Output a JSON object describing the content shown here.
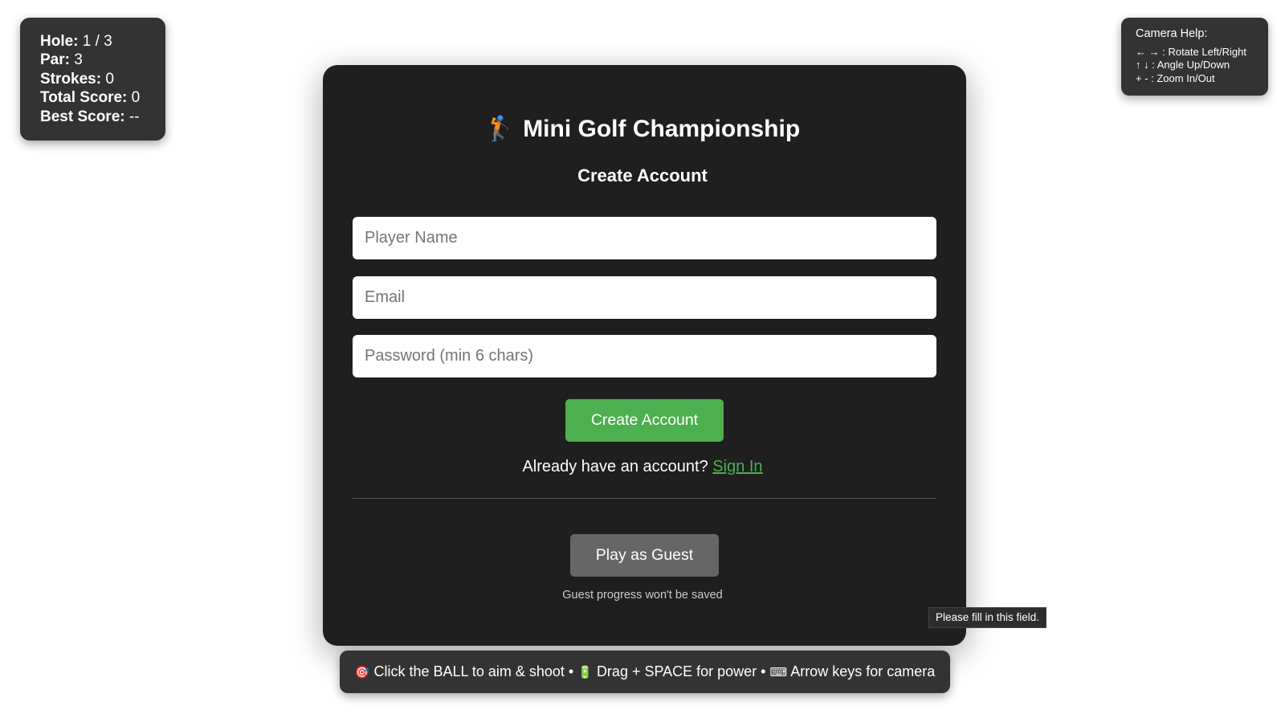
{
  "stats": {
    "hole_label": "Hole:",
    "hole_value": "1 / 3",
    "par_label": "Par:",
    "par_value": "3",
    "strokes_label": "Strokes:",
    "strokes_value": "0",
    "total_label": "Total Score:",
    "total_value": "0",
    "best_label": "Best Score:",
    "best_value": "--"
  },
  "camera_help": {
    "title": "Camera Help:",
    "rotate": "← → : Rotate Left/Right",
    "angle": "↑ ↓ : Angle Up/Down",
    "zoom": "+ - : Zoom In/Out"
  },
  "modal": {
    "title_icon": "golfer-icon",
    "title_glyph": "🏌",
    "title": "Mini Golf Championship",
    "subtitle": "Create Account",
    "player_name_placeholder": "Player Name",
    "player_name_value": "",
    "email_placeholder": "Email",
    "email_value": "",
    "password_placeholder": "Password (min 6 chars)",
    "password_value": "",
    "create_button": "Create Account",
    "signin_prompt": "Already have an account?",
    "signin_link": "Sign In",
    "guest_button": "Play as Guest",
    "guest_note": "Guest progress won't be saved"
  },
  "tooltip": {
    "text": "Please fill in this field."
  },
  "bottom_bar": {
    "target_glyph": "🎯",
    "target_icon": "target-icon",
    "aim_text": "Click the BALL to aim & shoot •",
    "battery_glyph": "🔋",
    "battery_icon": "battery-icon",
    "power_text": "Drag + SPACE for power •",
    "keyboard_glyph": "⌨",
    "keyboard_icon": "keyboard-icon",
    "camera_text": "Arrow keys for camera"
  },
  "colors": {
    "accent_green": "#4caf50",
    "panel_dark": "#333333",
    "modal_bg": "#1f1f1f",
    "guest_gray": "#666666"
  }
}
